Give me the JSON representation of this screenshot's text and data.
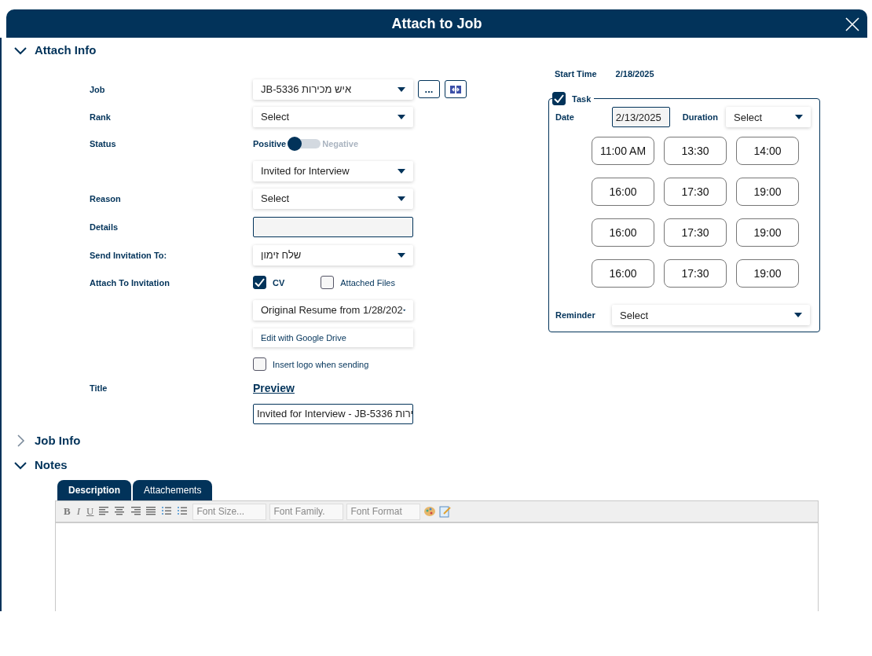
{
  "window": {
    "title": "Attach to Job"
  },
  "attach_info": {
    "label": "Attach Info",
    "expanded": true,
    "fields": [
      {
        "kind": "job",
        "label": "Job",
        "value": "JB-5336 איש מכירות",
        "more": "..."
      },
      {
        "kind": "dropdown",
        "label": "Rank",
        "value": "Select"
      },
      {
        "kind": "toggle",
        "label": "Status",
        "on_label": "Positive",
        "off_label": "Negative",
        "positive": true
      },
      {
        "kind": "status_dropdown",
        "value": "Invited for Interview"
      },
      {
        "kind": "dropdown",
        "label": "Reason",
        "value": "Select"
      },
      {
        "kind": "input",
        "label": "Details"
      },
      {
        "kind": "dropdown",
        "label": "Send Invitation To:",
        "value": "שלח זימון"
      },
      {
        "kind": "checkboxes",
        "label": "Attach To Invitation",
        "options": [
          {
            "label": "CV",
            "checked": true
          },
          {
            "label": "Attached Files",
            "checked": false
          }
        ]
      },
      {
        "kind": "file_dropdown",
        "value": "Original Resume from 1/28/202"
      },
      {
        "kind": "button",
        "value": "Edit with Google Drive"
      },
      {
        "kind": "checkbox",
        "value": "Insert logo when sending",
        "checked": false
      },
      {
        "kind": "link",
        "label": "Title",
        "value": "Preview"
      },
      {
        "kind": "input",
        "value": "Invited for Interview - JB-5336 ירות"
      }
    ],
    "start_time": {
      "label": "Start Time",
      "value": "2/18/2025"
    },
    "task": {
      "label": "Task",
      "checked": true,
      "date_label": "Date",
      "date": "2/13/2025",
      "duration_label": "Duration",
      "duration": "Select",
      "times": [
        "11:00 AM",
        "13:30",
        "14:00",
        "16:00",
        "17:30",
        "19:00",
        "16:00",
        "17:30",
        "19:00",
        "16:00",
        "17:30",
        "19:00"
      ],
      "reminder_label": "Reminder",
      "reminder": "Select"
    }
  },
  "job_info": {
    "label": "Job Info",
    "expanded": false
  },
  "notes": {
    "label": "Notes",
    "expanded": true,
    "tabs": [
      {
        "label": "Description",
        "selected": true
      },
      {
        "label": "Attachements",
        "selected": false
      }
    ],
    "format_buttons": [
      "B",
      "I",
      "U"
    ],
    "font_fields": [
      "Font Size...",
      "Font Family.",
      "Font Format"
    ]
  }
}
